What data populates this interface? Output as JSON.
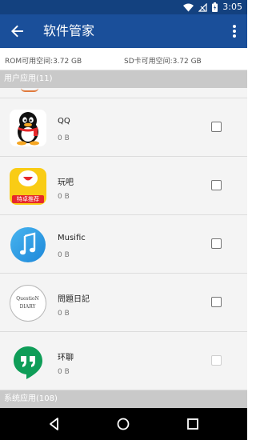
{
  "status_bar": {
    "time": "3:05",
    "icons": [
      "wifi-icon",
      "no-signal-icon",
      "battery-icon"
    ]
  },
  "app_bar": {
    "title": "软件管家",
    "back_icon": "arrow-left-icon",
    "menu_icon": "more-vert-icon",
    "color": "#1a4f9a"
  },
  "storage": {
    "rom": "ROM可用空间:3.72 GB",
    "sd": "SD卡可用空间:3.72 GB"
  },
  "sections": {
    "user_apps": "用户应用(11)",
    "system_apps": "系统应用(108)"
  },
  "apps": [
    {
      "name": "QQ",
      "size": "0 B",
      "icon": "qq-penguin-icon",
      "checked": false,
      "enabled": true
    },
    {
      "name": "玩吧",
      "size": "0 B",
      "icon": "wanba-icon",
      "badge": "特卓推荐",
      "checked": false,
      "enabled": true
    },
    {
      "name": "Musific",
      "size": "0 B",
      "icon": "music-note-icon",
      "checked": false,
      "enabled": true
    },
    {
      "name": "問題日記",
      "size": "0 B",
      "icon": "question-diary-icon",
      "icon_text_top": "QuestioN",
      "icon_text_bottom": "DIARY",
      "checked": false,
      "enabled": true
    },
    {
      "name": "环聊",
      "size": "0 B",
      "icon": "hangouts-icon",
      "checked": false,
      "enabled": false
    }
  ],
  "nav": [
    "back-triangle-icon",
    "home-circle-icon",
    "recents-square-icon"
  ]
}
